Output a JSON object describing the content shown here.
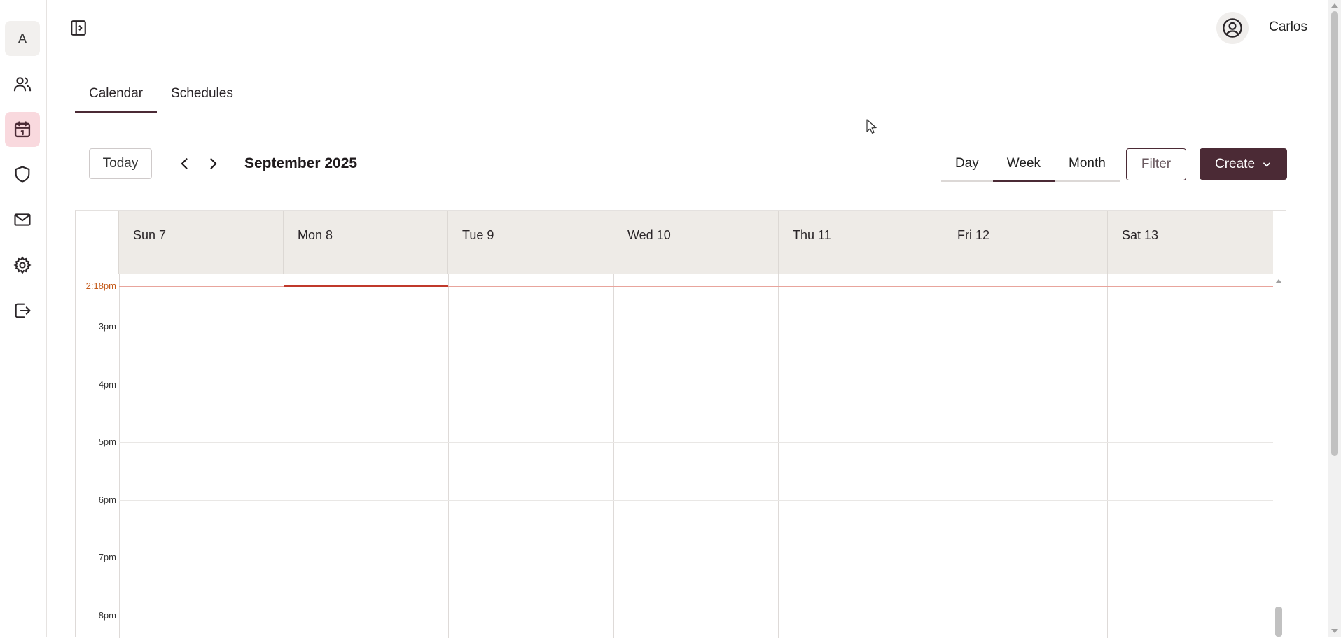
{
  "sidebar": {
    "org_initial": "A",
    "items": [
      {
        "name": "people-icon"
      },
      {
        "name": "calendar-icon",
        "active": true
      },
      {
        "name": "shield-icon"
      },
      {
        "name": "mail-icon"
      },
      {
        "name": "gear-icon"
      },
      {
        "name": "logout-icon"
      }
    ]
  },
  "header": {
    "user_name": "Carlos"
  },
  "tabs": [
    {
      "label": "Calendar",
      "active": true
    },
    {
      "label": "Schedules",
      "active": false
    }
  ],
  "toolbar": {
    "today_label": "Today",
    "period_title": "September 2025",
    "views": [
      {
        "label": "Day"
      },
      {
        "label": "Week",
        "active": true
      },
      {
        "label": "Month"
      }
    ],
    "filter_label": "Filter",
    "create_label": "Create"
  },
  "calendar": {
    "days": [
      "Sun 7",
      "Mon 8",
      "Tue 9",
      "Wed 10",
      "Thu 11",
      "Fri 12",
      "Sat 13"
    ],
    "current_time_label": "2:18pm",
    "hours": [
      "3pm",
      "4pm",
      "5pm",
      "6pm",
      "7pm",
      "8pm"
    ],
    "today_index": 1
  },
  "colors": {
    "accent": "#4b2a35",
    "header_bg": "#eeebe7",
    "now_line": "#c0392b",
    "active_nav_bg": "#f9d9de"
  }
}
